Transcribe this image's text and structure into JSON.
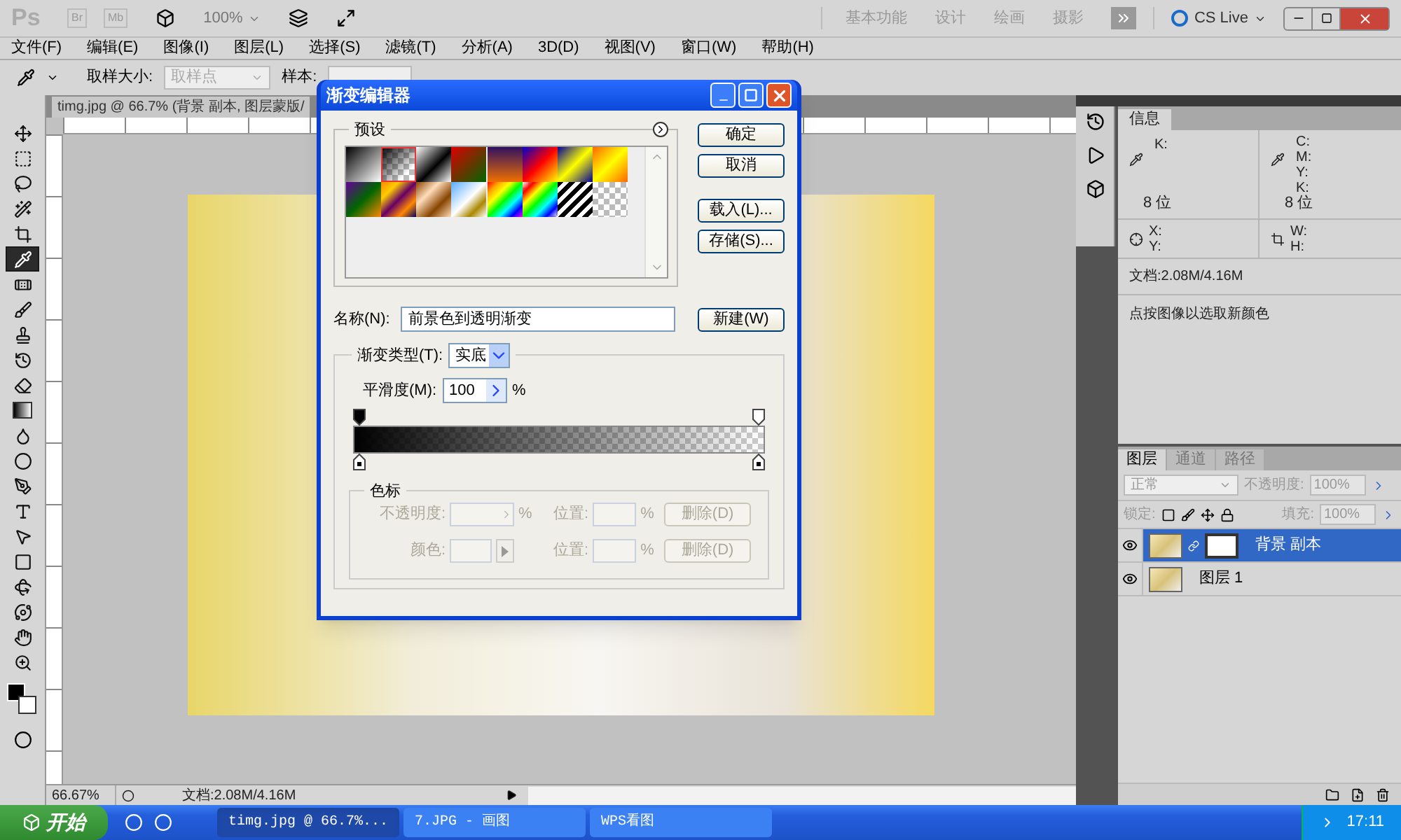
{
  "app_bar": {
    "logo": "Ps",
    "bridge": "Br",
    "mini_bridge": "Mb",
    "zoom": "100%",
    "workspaces": [
      "基本功能",
      "设计",
      "绘画",
      "摄影"
    ],
    "cs_live": "CS Live"
  },
  "menu": [
    "文件(F)",
    "编辑(E)",
    "图像(I)",
    "图层(L)",
    "选择(S)",
    "滤镜(T)",
    "分析(A)",
    "3D(D)",
    "视图(V)",
    "窗口(W)",
    "帮助(H)"
  ],
  "options_bar": {
    "sample_size_label": "取样大小:",
    "sample_size": "取样点",
    "sample_label": "样本:"
  },
  "tools": [
    {
      "kind": "move",
      "selected": false
    },
    {
      "kind": "marquee",
      "selected": false
    },
    {
      "kind": "lasso",
      "selected": false
    },
    {
      "kind": "wand",
      "selected": false
    },
    {
      "kind": "crop",
      "selected": false
    },
    {
      "kind": "eyedropper",
      "selected": true
    },
    {
      "kind": "healing",
      "selected": false
    },
    {
      "kind": "brush",
      "selected": false
    },
    {
      "kind": "stamp",
      "selected": false
    },
    {
      "kind": "history",
      "selected": false
    },
    {
      "kind": "eraser",
      "selected": false
    },
    {
      "kind": "gradient",
      "selected": false
    },
    {
      "kind": "blur",
      "selected": false
    },
    {
      "kind": "dodge",
      "selected": false
    },
    {
      "kind": "pen",
      "selected": false
    },
    {
      "kind": "type",
      "selected": false
    },
    {
      "kind": "select",
      "selected": false
    },
    {
      "kind": "shape",
      "selected": false
    },
    {
      "kind": "rotate",
      "selected": false
    },
    {
      "kind": "orbit",
      "selected": false
    },
    {
      "kind": "hand",
      "selected": false
    },
    {
      "kind": "zoom",
      "selected": false
    }
  ],
  "document": {
    "tab_title": "timg.jpg @ 66.7% (背景 副本, 图层蒙版/",
    "zoom": "66.67%",
    "doc_info": "文档:2.08M/4.16M"
  },
  "dialog": {
    "title": "渐变编辑器",
    "presets_label": "预设",
    "presets": [
      {
        "selected": false
      },
      {
        "selected": true
      },
      {
        "selected": false
      },
      {
        "selected": false
      },
      {
        "selected": false
      },
      {
        "selected": false
      },
      {
        "selected": false
      },
      {
        "selected": false
      },
      {
        "selected": false
      },
      {
        "selected": false
      },
      {
        "selected": false
      },
      {
        "selected": false
      },
      {
        "selected": false
      },
      {
        "selected": false
      },
      {
        "selected": false
      },
      {
        "selected": false
      }
    ],
    "buttons": [
      "确定",
      "取消",
      "载入(L)...",
      "存储(S)..."
    ],
    "name_label": "名称(N):",
    "name_value": "前景色到透明渐变",
    "new_button": "新建(W)",
    "type_label": "渐变类型(T):",
    "type_value": "实底",
    "smooth_label": "平滑度(M):",
    "smooth_value": "100",
    "smooth_unit": "%",
    "stops": {
      "title": "色标",
      "disabled": true,
      "opacity_label": "不透明度:",
      "opacity_unit": "%",
      "location_label": "位置:",
      "location_unit": "%",
      "delete": "删除(D)",
      "color_label": "颜色:",
      "location_label_2": "位置:",
      "location_unit_2": "%",
      "delete_2": "删除(D)"
    }
  },
  "info_panel": {
    "tab": "信息",
    "left_channels": [
      "K:"
    ],
    "right_channels": [
      "C:",
      "M:",
      "Y:",
      "K:"
    ],
    "left_bits": "8 位",
    "right_bits": "8 位",
    "xy": [
      "X:",
      "Y:"
    ],
    "wh": [
      "W:",
      "H:"
    ],
    "doc": "文档:2.08M/4.16M",
    "hint": "点按图像以选取新颜色"
  },
  "layers_panel": {
    "tabs": [
      {
        "label": "图层",
        "selected": true
      },
      {
        "label": "通道",
        "selected": false
      },
      {
        "label": "路径",
        "selected": false
      }
    ],
    "blend": "正常",
    "opacity_label": "不透明度:",
    "opacity": "100%",
    "lock_label": "锁定:",
    "fill_label": "填充:",
    "fill": "100%",
    "layers": [
      {
        "name": "背景 副本",
        "selected": true,
        "visible": true,
        "mask": true
      },
      {
        "name": "图层 1",
        "selected": false,
        "visible": true,
        "mask": false
      }
    ]
  },
  "taskbar": {
    "start": "开始",
    "tasks": [
      {
        "label": "timg.jpg @ 66.7%...",
        "selected": true
      },
      {
        "label": "7.JPG - 画图",
        "selected": false
      },
      {
        "label": "WPS看图",
        "selected": false
      }
    ],
    "time": "17:11"
  }
}
